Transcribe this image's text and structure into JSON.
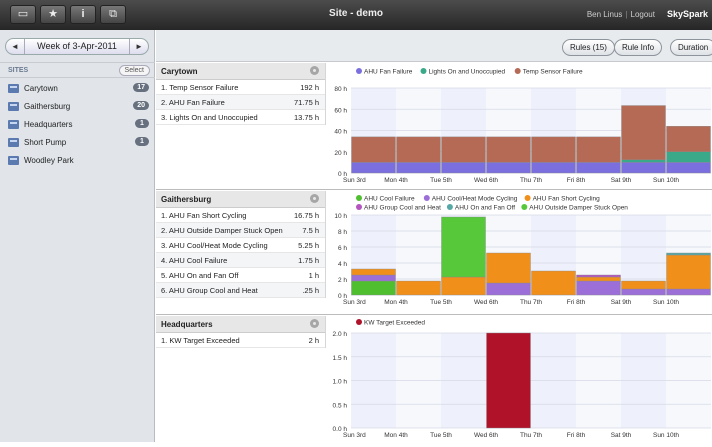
{
  "app": {
    "title": "Site - demo",
    "user": "Ben Linus",
    "logout": "Logout",
    "brand": "SkySpark"
  },
  "toolbar": {
    "icons": [
      "window-icon",
      "star-icon",
      "info-icon",
      "copy-icon"
    ]
  },
  "week": {
    "label": "Week of 3-Apr-2011",
    "prev": "◄",
    "next": "►"
  },
  "sites": {
    "header": "SITES",
    "select_label": "Select",
    "items": [
      {
        "name": "Carytown",
        "count": "17"
      },
      {
        "name": "Gaithersburg",
        "count": "20"
      },
      {
        "name": "Headquarters",
        "count": "1"
      },
      {
        "name": "Short Pump",
        "count": "1"
      },
      {
        "name": "Woodley Park",
        "count": ""
      }
    ]
  },
  "buttons": {
    "rules": "Rules (15)",
    "rule_info": "Rule Info",
    "duration": "Duration"
  },
  "panels": [
    {
      "title": "Carytown",
      "rows": [
        [
          "1. Temp Sensor Failure",
          "192 h"
        ],
        [
          "2. AHU Fan Failure",
          "71.75 h"
        ],
        [
          "3. Lights On and Unoccupied",
          "13.75 h"
        ]
      ]
    },
    {
      "title": "Gaithersburg",
      "rows": [
        [
          "1. AHU Fan Short Cycling",
          "16.75 h"
        ],
        [
          "2. AHU Outside Damper Stuck Open",
          "7.5 h"
        ],
        [
          "3. AHU Cool/Heat Mode Cycling",
          "5.25 h"
        ],
        [
          "4. AHU Cool Failure",
          "1.75 h"
        ],
        [
          "5. AHU On and Fan Off",
          "1 h"
        ],
        [
          "6. AHU Group Cool and Heat",
          ".25 h"
        ]
      ]
    },
    {
      "title": "Headquarters",
      "rows": [
        [
          "1. KW Target Exceeded",
          "2 h"
        ]
      ]
    }
  ],
  "chart_data": [
    {
      "type": "bar",
      "stacked": true,
      "categories": [
        "Sun 3rd",
        "Mon 4th",
        "Tue 5th",
        "Wed 6th",
        "Thu 7th",
        "Fri 8th",
        "Sat 9th",
        "Sun 10th"
      ],
      "yticks": [
        "0 h",
        "20 h",
        "40 h",
        "60 h",
        "80 h"
      ],
      "ylim": [
        0,
        80
      ],
      "legend_position": "top-left",
      "series": [
        {
          "name": "AHU Fan Failure",
          "color": "#7b6fe0",
          "values": [
            10,
            10,
            10,
            10,
            10,
            10,
            10,
            10
          ]
        },
        {
          "name": "Lights On and Unoccupied",
          "color": "#3aa98a",
          "values": [
            0,
            0,
            0,
            0,
            0,
            0,
            2.5,
            10
          ]
        },
        {
          "name": "Temp Sensor Failure",
          "color": "#b56a55",
          "values": [
            24,
            24,
            24,
            24,
            24,
            24,
            51,
            24
          ]
        }
      ]
    },
    {
      "type": "bar",
      "stacked": true,
      "categories": [
        "Sun 3rd",
        "Mon 4th",
        "Tue 5th",
        "Wed 6th",
        "Thu 7th",
        "Fri 8th",
        "Sat 9th",
        "Sun 10th"
      ],
      "yticks": [
        "0 h",
        "2 h",
        "4 h",
        "6 h",
        "8 h",
        "10 h"
      ],
      "ylim": [
        0,
        10
      ],
      "legend_position": "top-left",
      "series": [
        {
          "name": "AHU Cool Failure",
          "color": "#4fbf2f",
          "values": [
            1.75,
            0,
            0,
            0,
            0,
            0,
            0,
            0
          ]
        },
        {
          "name": "AHU Cool/Heat Mode Cycling",
          "color": "#9c6fd8",
          "values": [
            0.75,
            0,
            0,
            1.5,
            0,
            1.75,
            0.75,
            0.75
          ]
        },
        {
          "name": "AHU Fan Short Cycling",
          "color": "#f0901a",
          "values": [
            0.75,
            1.75,
            2.25,
            3.75,
            3,
            0.5,
            1,
            4.25
          ]
        },
        {
          "name": "AHU Group Cool and Heat",
          "color": "#b455c0",
          "values": [
            0,
            0,
            0,
            0,
            0,
            0.25,
            0,
            0
          ]
        },
        {
          "name": "AHU On and Fan Off",
          "color": "#55a8a6",
          "values": [
            0,
            0,
            0,
            0,
            0,
            0,
            0,
            0.25
          ]
        },
        {
          "name": "AHU Outside Damper Stuck Open",
          "color": "#56c83a",
          "values": [
            0,
            0,
            7.5,
            0,
            0,
            0,
            0,
            0
          ]
        }
      ]
    },
    {
      "type": "bar",
      "categories": [
        "Sun 3rd",
        "Mon 4th",
        "Tue 5th",
        "Wed 6th",
        "Thu 7th",
        "Fri 8th",
        "Sat 9th",
        "Sun 10th"
      ],
      "yticks": [
        "0.0 h",
        "0.5 h",
        "1.0 h",
        "1.5 h",
        "2.0 h"
      ],
      "ylim": [
        0,
        2
      ],
      "legend_position": "top-left",
      "series": [
        {
          "name": "KW Target Exceeded",
          "color": "#b0122a",
          "values": [
            0,
            0,
            0,
            2,
            0,
            0,
            0,
            0
          ]
        }
      ]
    }
  ]
}
